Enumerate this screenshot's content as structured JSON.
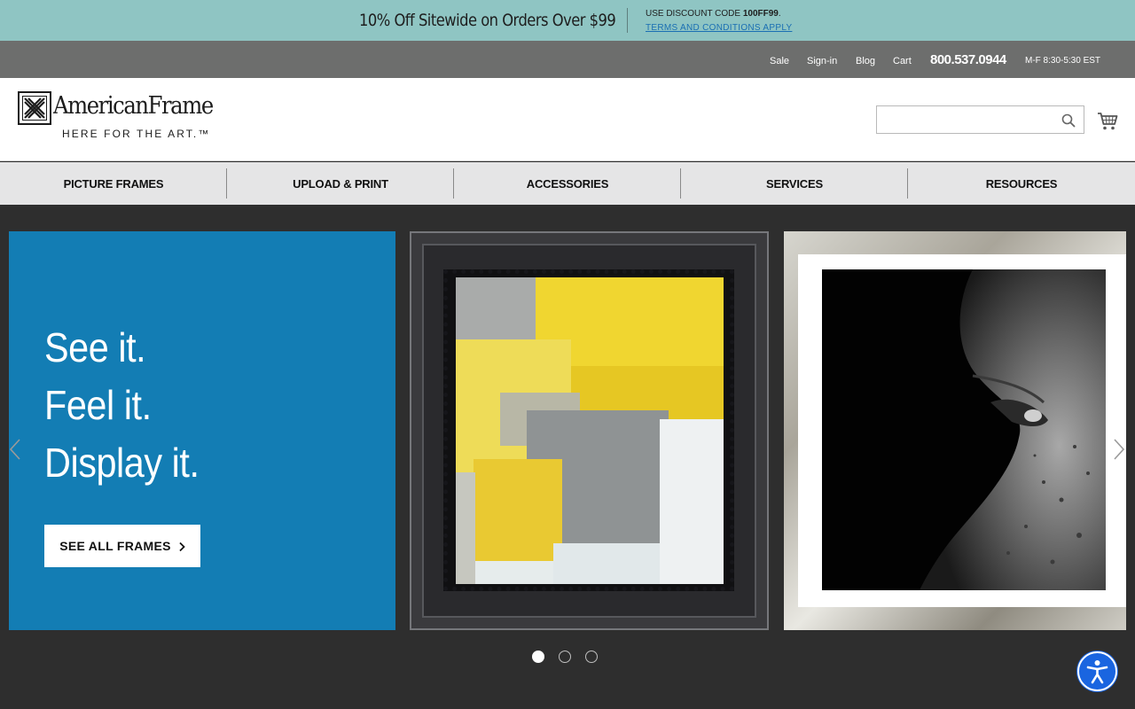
{
  "promo": {
    "headline": "10% Off Sitewide on Orders Over $99",
    "code_prefix": "USE DISCOUNT CODE ",
    "code": "100FF99",
    "code_suffix": ".",
    "terms": "TERMS AND CONDITIONS APPLY"
  },
  "utility": {
    "links": [
      "Sale",
      "Sign-in",
      "Blog",
      "Cart"
    ],
    "phone": "800.537.0944",
    "hours": "M-F 8:30-5:30 EST"
  },
  "header": {
    "logo_name": "AmericanFrame",
    "logo_tagline": "HERE FOR THE ART.™",
    "search_value": "",
    "search_placeholder": ""
  },
  "nav": {
    "items": [
      "PICTURE FRAMES",
      "UPLOAD & PRINT",
      "ACCESSORIES",
      "SERVICES",
      "RESOURCES"
    ]
  },
  "hero": {
    "slogan": [
      "See it.",
      "Feel it.",
      "Display it."
    ],
    "cta_label": "SEE ALL FRAMES",
    "slide_count": 3,
    "active_slide": 1,
    "panel_color": "#137db4"
  },
  "colors": {
    "promo_bg": "#8fc5c3",
    "utility_bg": "#6d6e6d",
    "nav_bg": "#e5e5e6",
    "hero_bg": "#2e2e2e",
    "accessibility": "#1a65e0"
  },
  "icons": {
    "search": "search-icon",
    "cart": "cart-icon",
    "prev": "chevron-left-icon",
    "next": "chevron-right-icon",
    "cta": "chevron-right-icon",
    "accessibility": "accessibility-icon"
  }
}
